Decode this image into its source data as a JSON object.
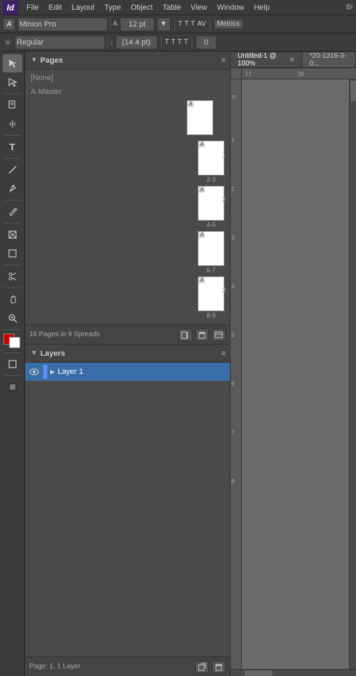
{
  "app": {
    "logo": "Id",
    "logo_bg": "#3d1f6b"
  },
  "menubar": {
    "items": [
      "File",
      "Edit",
      "Layout",
      "Type",
      "Object",
      "Table",
      "View",
      "Window",
      "Help"
    ]
  },
  "toolbar1": {
    "font_label": "A",
    "font_name": "Minion Pro",
    "font_size_icon": "A",
    "font_size_value": "12 pt",
    "font_style": "Regular",
    "font_size2_value": "(14.4 pt)",
    "metrics_btn": "Metrics",
    "align_icon": "≡"
  },
  "tabs": {
    "items": [
      {
        "label": "Untitled-1 @ 100%",
        "active": true,
        "closeable": true
      },
      {
        "label": "*20-1316-3-0...",
        "active": false,
        "closeable": false
      }
    ]
  },
  "pages_panel": {
    "title": "Pages",
    "none_label": "[None]",
    "master_label": "A-Master",
    "spreads": [
      {
        "pages": [
          "A"
        ],
        "numbers": "2-3",
        "spread_num": "1"
      },
      {
        "pages": [
          "A"
        ],
        "numbers": "4-5",
        "spread_num": "2"
      },
      {
        "pages": [
          "A"
        ],
        "numbers": "6-7",
        "spread_num": ""
      },
      {
        "pages": [
          "A"
        ],
        "numbers": "8-9",
        "spread_num": "3"
      }
    ],
    "footer_text": "16 Pages in 9 Spreads"
  },
  "layers_panel": {
    "title": "Layers",
    "layers": [
      {
        "name": "Layer 1",
        "visible": true,
        "color": "#5b8ef5",
        "selected": true,
        "expanded": false
      }
    ],
    "footer_text": "Page: 1, 1 Layer"
  },
  "rulers": {
    "h_marks": [
      "17",
      "",
      "",
      "",
      "",
      "",
      "",
      "",
      "",
      "16"
    ],
    "v_marks": [
      "0",
      "1",
      "2",
      "3",
      "4",
      "5",
      "6",
      "7",
      "8"
    ]
  }
}
